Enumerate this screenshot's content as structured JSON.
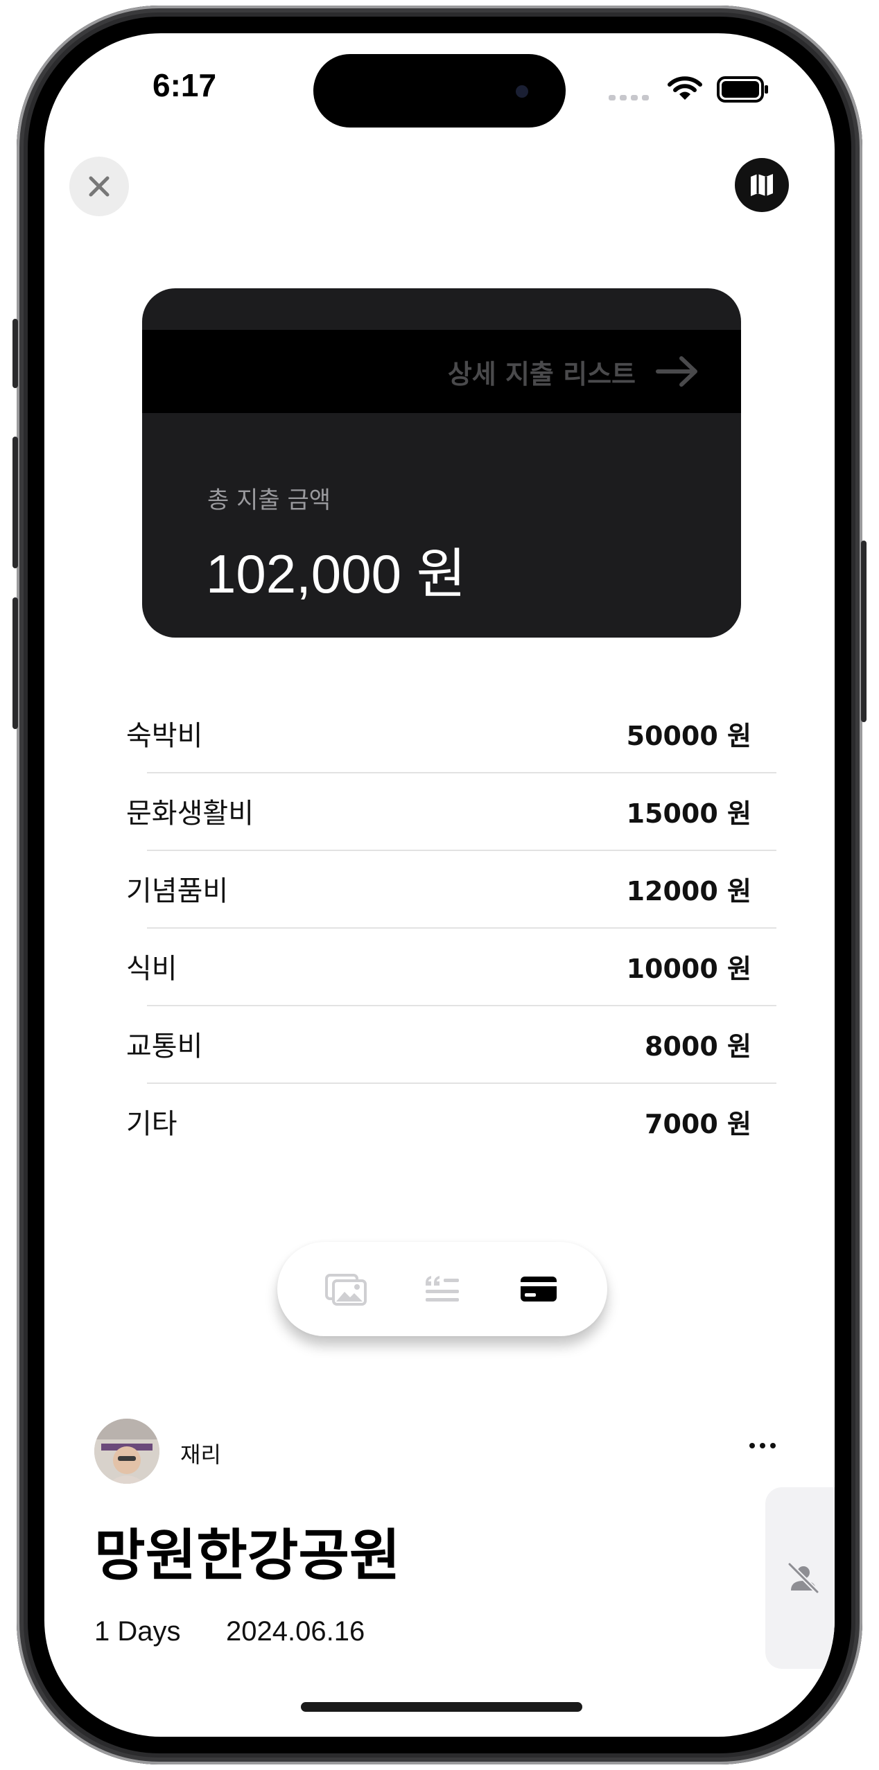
{
  "status_bar": {
    "time": "6:17"
  },
  "top_bar": {
    "close_icon": "close-icon",
    "map_icon": "map-icon"
  },
  "summary_card": {
    "detail_link": "상세 지출 리스트",
    "total_label": "총 지출 금액",
    "total_value": "102,000 원"
  },
  "expenses": [
    {
      "name": "숙박비",
      "amount": "50000 원"
    },
    {
      "name": "문화생활비",
      "amount": "15000 원"
    },
    {
      "name": "기념품비",
      "amount": "12000 원"
    },
    {
      "name": "식비",
      "amount": "10000 원"
    },
    {
      "name": "교통비",
      "amount": "8000 원"
    },
    {
      "name": "기타",
      "amount": "7000 원"
    }
  ],
  "segment": {
    "items": [
      "photos-icon",
      "quote-icon",
      "card-icon"
    ],
    "selected": "card-icon"
  },
  "author": {
    "name": "재리"
  },
  "trip": {
    "title": "망원한강공원",
    "days": "1 Days",
    "date": "2024.06.16"
  },
  "colors": {
    "card_bg": "#1c1c1e",
    "strip_bg": "#000000",
    "muted_text": "#9a9a9e",
    "inactive_icon": "#cfcfd2"
  }
}
